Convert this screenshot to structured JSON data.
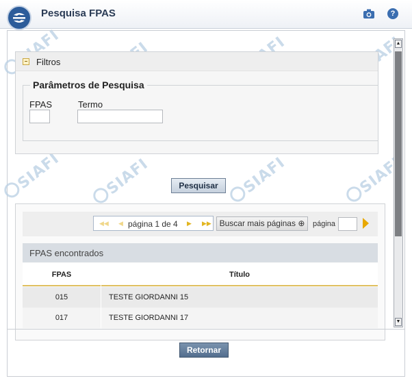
{
  "window": {
    "title": "Pesquisa FPAS"
  },
  "header": {
    "camera_icon": "camera-icon",
    "help_icon": "help-icon",
    "help_glyph": "?"
  },
  "filters": {
    "section_label": "Filtros",
    "legend": "Parâmetros de Pesquisa",
    "fpas_label": "FPAS",
    "fpas_value": "",
    "termo_label": "Termo",
    "termo_value": ""
  },
  "actions": {
    "search_label": "Pesquisar",
    "return_label": "Retornar"
  },
  "pager": {
    "page_text": "página 1 de 4",
    "more_pages_label": "Buscar mais páginas",
    "page_field_label": "página",
    "page_field_value": ""
  },
  "results": {
    "title": "FPAS encontrados",
    "columns": [
      "FPAS",
      "Título"
    ],
    "rows": [
      {
        "fpas": "015",
        "titulo": "TESTE GIORDANNI 15"
      },
      {
        "fpas": "017",
        "titulo": "TESTE GIORDANNI 17"
      }
    ]
  },
  "watermark": "SIAFI",
  "colors": {
    "accent": "#2c5c9a",
    "button_dark": "#536e8e",
    "pager_arrow": "#e2b520"
  }
}
